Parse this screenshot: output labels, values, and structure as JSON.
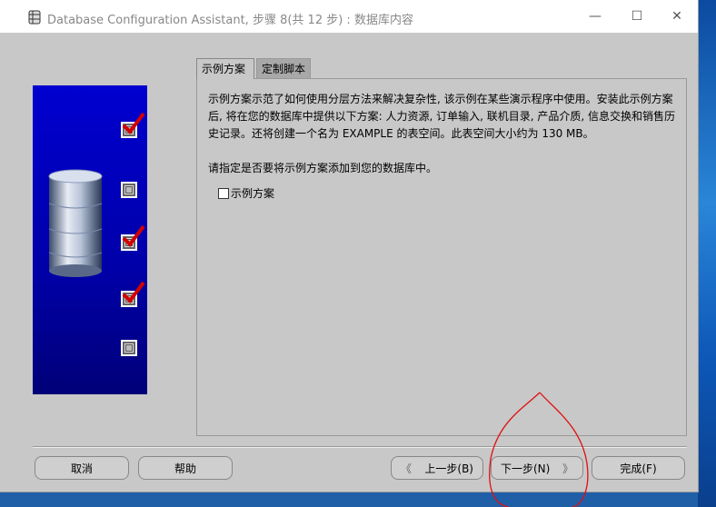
{
  "window": {
    "title": "Database Configuration Assistant, 步骤 8(共 12 步) : 数据库内容",
    "controls": {
      "minimize": "—",
      "maximize": "☐",
      "close": "✕"
    }
  },
  "tabs": [
    {
      "label": "示例方案",
      "selected": true
    },
    {
      "label": "定制脚本",
      "selected": false
    }
  ],
  "content": {
    "description": "示例方案示范了如何使用分层方法来解决复杂性, 该示例在某些演示程序中使用。安装此示例方案后, 将在您的数据库中提供以下方案: 人力资源, 订单输入, 联机目录, 产品介质, 信息交换和销售历史记录。还将创建一个名为 EXAMPLE 的表空间。此表空间大小约为 130 MB。",
    "question": "请指定是否要将示例方案添加到您的数据库中。",
    "checkbox": {
      "label": "示例方案",
      "checked": false
    }
  },
  "steps": [
    {
      "completed": true
    },
    {
      "completed": false
    },
    {
      "completed": true
    },
    {
      "completed": true
    },
    {
      "completed": false
    }
  ],
  "buttons": {
    "cancel": "取消",
    "help": "帮助",
    "back": "上一步(B)",
    "next": "下一步(N)",
    "finish": "完成(F)",
    "back_arrow": "《",
    "next_arrow": "》"
  },
  "colors": {
    "accent_check": "#d40000",
    "panel_blue": "#0000c0",
    "annotation": "#e01010"
  }
}
